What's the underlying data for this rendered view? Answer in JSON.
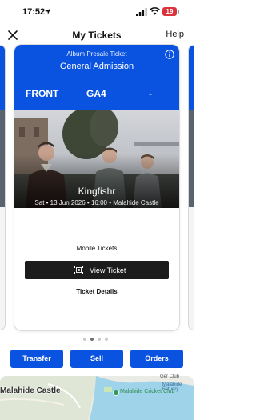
{
  "status_bar": {
    "time": "17:52",
    "battery": "19"
  },
  "nav": {
    "title": "My Tickets",
    "help": "Help"
  },
  "ticket": {
    "presale_label": "Album Presale Ticket",
    "admission": "General Admission",
    "seat": {
      "section": "FRONT",
      "row": "GA4",
      "seat": "-"
    },
    "artist": "Kingfishr",
    "event_meta": "Sat • 13 Jun 2026 • 16:00 • Malahide Castle",
    "mobile_tickets": "Mobile Tickets",
    "view_ticket": "View Ticket",
    "ticket_details": "Ticket Details"
  },
  "pager": {
    "count": 4,
    "active_index": 1
  },
  "actions": {
    "transfer": "Transfer",
    "sell": "Sell",
    "orders": "Orders"
  },
  "map": {
    "castle_label": "Malahide Castle",
    "club_label": "Malahide Cricket Club",
    "estuary_label": "Malahide Estuary",
    "top_label": "Ger Club"
  },
  "colors": {
    "brand_blue": "#0a53e0",
    "button_dark": "#1c1c1c",
    "battery_red": "#d9343c"
  }
}
